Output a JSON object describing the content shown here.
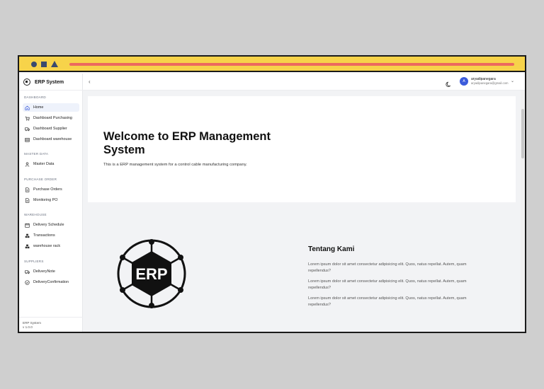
{
  "app": {
    "brand": "ERP System"
  },
  "sidebar": {
    "sections": [
      {
        "label": "DASHBOARD",
        "items": [
          {
            "label": "Home",
            "icon": "home-icon",
            "active": true
          },
          {
            "label": "Dashboard Purchasing",
            "icon": "cart-icon"
          },
          {
            "label": "Dashboard Supplier",
            "icon": "truck-icon"
          },
          {
            "label": "Dashboard warehouse",
            "icon": "warehouse-icon"
          }
        ]
      },
      {
        "label": "MASTER DATA",
        "items": [
          {
            "label": "Master Data",
            "icon": "user-icon"
          }
        ]
      },
      {
        "label": "PURCHASE ORDER",
        "items": [
          {
            "label": "Purchase Orders",
            "icon": "document-icon"
          },
          {
            "label": "Monitoring PO",
            "icon": "document-icon"
          }
        ]
      },
      {
        "label": "WAREHOUSE",
        "items": [
          {
            "label": "Delivery Schedule",
            "icon": "calendar-icon"
          },
          {
            "label": "Transactions",
            "icon": "boxes-icon"
          },
          {
            "label": "warehouse rack",
            "icon": "boxes-icon"
          }
        ]
      },
      {
        "label": "SUPPLIERS",
        "items": [
          {
            "label": "DeliveryNote",
            "icon": "truck-icon"
          },
          {
            "label": "DeliveryConfirmation",
            "icon": "check-circle-icon"
          }
        ]
      }
    ],
    "footer": {
      "line1": "ERP System",
      "line2": "v 1.0.0"
    }
  },
  "topbar": {
    "back": "‹",
    "user": {
      "initial": "A",
      "name": "aryadipanegara",
      "email": "aryadipanegara@gmail.com"
    },
    "chevron": "⌄"
  },
  "hero": {
    "title": "Welcome to ERP Management System",
    "subtitle": "This is a ERP management system for a control cable manufacturing company."
  },
  "about": {
    "title": "Tentang Kami",
    "paragraphs": [
      "Lorem ipsum dolor sit amet consectetur adipisicing elit. Quos, natus repellat. Autem, quam repellendus?",
      "Lorem ipsum dolor sit amet consectetur adipisicing elit. Quos, natus repellat. Autem, quam repellendus?",
      "Lorem ipsum dolor sit amet consectetur adipisicing elit. Quos, natus repellat. Autem, quam repellendus?"
    ],
    "logo_text": "ERP"
  },
  "colors": {
    "frame_bar": "#f7d34a",
    "url_bar": "#ec6a5e",
    "avatar": "#3b5bdb",
    "active_nav": "#eef2fb"
  }
}
